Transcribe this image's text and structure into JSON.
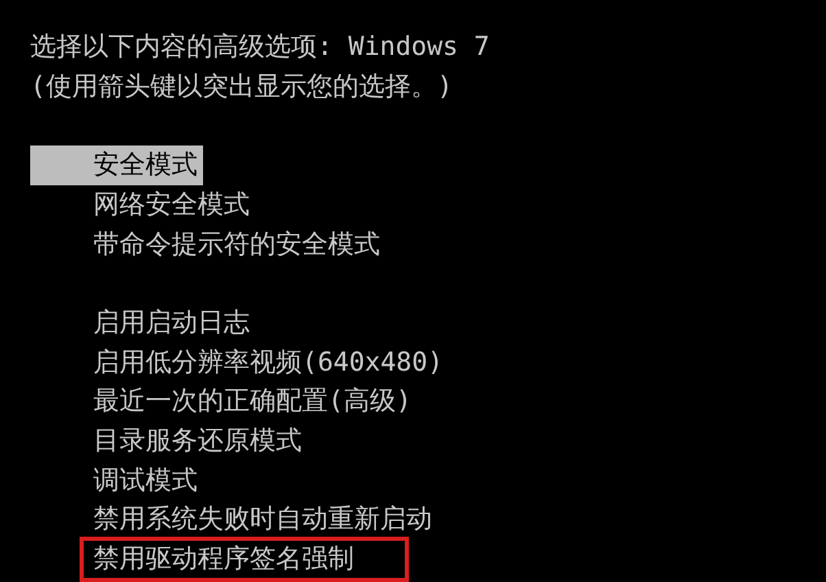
{
  "header": [
    "选择以下内容的高级选项: Windows 7",
    "(使用箭头键以突出显示您的选择。)"
  ],
  "groups": [
    [
      {
        "label": "安全模式",
        "selected": true,
        "outlined": false
      },
      {
        "label": "网络安全模式",
        "selected": false,
        "outlined": false
      },
      {
        "label": "带命令提示符的安全模式",
        "selected": false,
        "outlined": false
      }
    ],
    [
      {
        "label": "启用启动日志",
        "selected": false,
        "outlined": false
      },
      {
        "label": "启用低分辨率视频(640x480)",
        "selected": false,
        "outlined": false
      },
      {
        "label": "最近一次的正确配置(高级)",
        "selected": false,
        "outlined": false
      },
      {
        "label": "目录服务还原模式",
        "selected": false,
        "outlined": false
      },
      {
        "label": "调试模式",
        "selected": false,
        "outlined": false
      },
      {
        "label": "禁用系统失败时自动重新启动",
        "selected": false,
        "outlined": false
      },
      {
        "label": "禁用驱动程序签名强制",
        "selected": false,
        "outlined": true
      }
    ]
  ]
}
